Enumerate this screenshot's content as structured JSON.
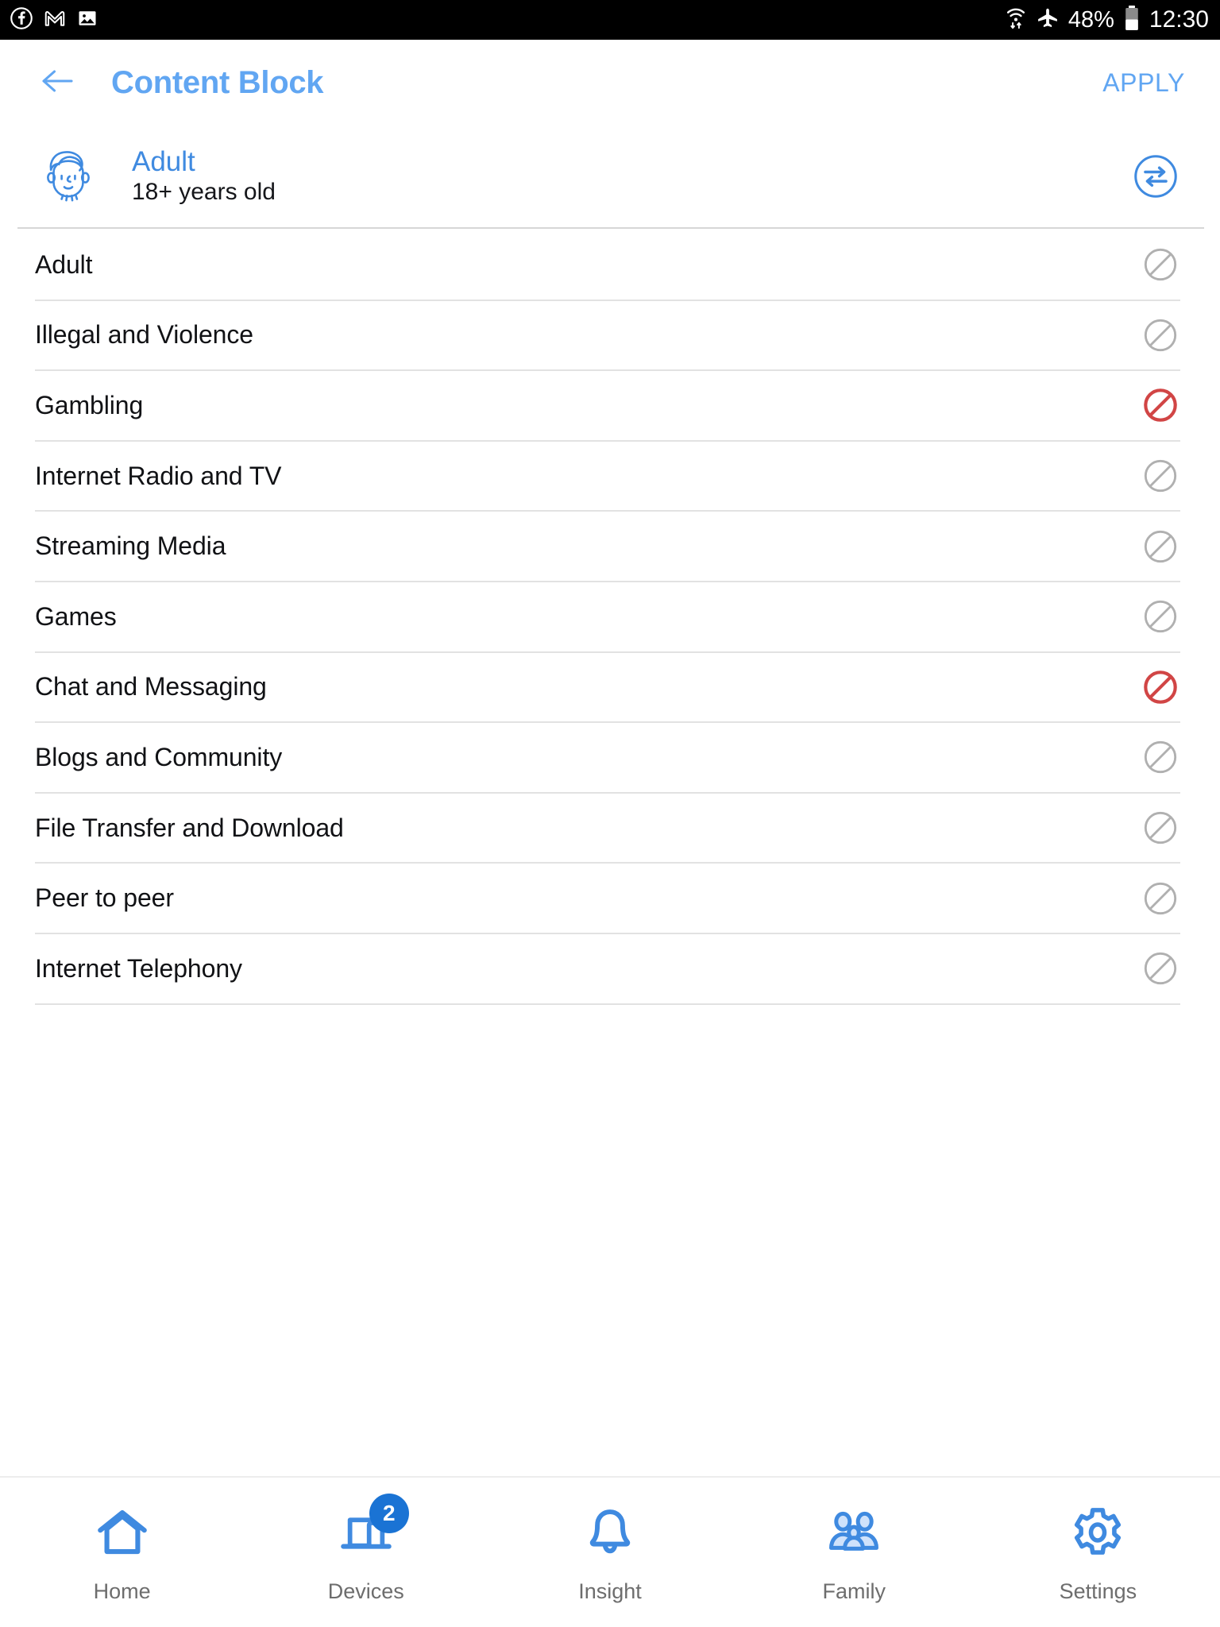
{
  "status_bar": {
    "left_icons": [
      "facebook-icon",
      "gmail-icon",
      "photo-icon"
    ],
    "right_icons": [
      "wifi-icon",
      "airplane-mode-icon",
      "battery-icon"
    ],
    "battery_percent": "48%",
    "time": "12:30"
  },
  "app_bar": {
    "back_label": "back-arrow",
    "title": "Content Block",
    "apply_label": "APPLY"
  },
  "profile": {
    "avatar_icon": "adult-face-avatar",
    "name": "Adult",
    "age": "18+ years old",
    "switch_icon": "swap-arrows-icon"
  },
  "colors": {
    "accent_blue": "#61a6f2",
    "profile_blue": "#3f8ae0",
    "blocked_red": "#d14545",
    "allowed_gray": "#b0b0b0",
    "nav_blue": "#3f8ae0",
    "badge_blue": "#1a73d4"
  },
  "categories": [
    {
      "label": "Adult",
      "state": "allowed",
      "icon": "block-circle-icon"
    },
    {
      "label": "Illegal and Violence",
      "state": "allowed",
      "icon": "block-circle-icon"
    },
    {
      "label": "Gambling",
      "state": "blocked",
      "icon": "block-circle-icon"
    },
    {
      "label": "Internet Radio and TV",
      "state": "allowed",
      "icon": "block-circle-icon"
    },
    {
      "label": "Streaming Media",
      "state": "allowed",
      "icon": "block-circle-icon"
    },
    {
      "label": "Games",
      "state": "allowed",
      "icon": "block-circle-icon"
    },
    {
      "label": "Chat and Messaging",
      "state": "blocked",
      "icon": "block-circle-icon"
    },
    {
      "label": "Blogs and Community",
      "state": "allowed",
      "icon": "block-circle-icon"
    },
    {
      "label": "File Transfer and Download",
      "state": "allowed",
      "icon": "block-circle-icon"
    },
    {
      "label": "Peer to peer",
      "state": "allowed",
      "icon": "block-circle-icon"
    },
    {
      "label": "Internet Telephony",
      "state": "allowed",
      "icon": "block-circle-icon"
    }
  ],
  "bottom_nav": [
    {
      "label": "Home",
      "icon": "home-icon",
      "badge": null
    },
    {
      "label": "Devices",
      "icon": "devices-icon",
      "badge": "2"
    },
    {
      "label": "Insight",
      "icon": "bell-icon",
      "badge": null
    },
    {
      "label": "Family",
      "icon": "family-icon",
      "badge": null
    },
    {
      "label": "Settings",
      "icon": "gear-icon",
      "badge": null
    }
  ]
}
